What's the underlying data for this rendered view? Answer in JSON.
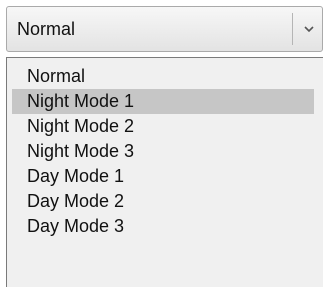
{
  "combo": {
    "value": "Normal",
    "arrow_icon": "chevron-down-icon"
  },
  "dropdown": {
    "selected_index": 1,
    "options": [
      {
        "label": "Normal"
      },
      {
        "label": "Night Mode 1"
      },
      {
        "label": "Night Mode 2"
      },
      {
        "label": "Night Mode 3"
      },
      {
        "label": "Day Mode 1"
      },
      {
        "label": "Day Mode 2"
      },
      {
        "label": "Day Mode 3"
      }
    ]
  },
  "colors": {
    "highlight": "#c6c6c6",
    "list_background": "#f0f0f0"
  }
}
